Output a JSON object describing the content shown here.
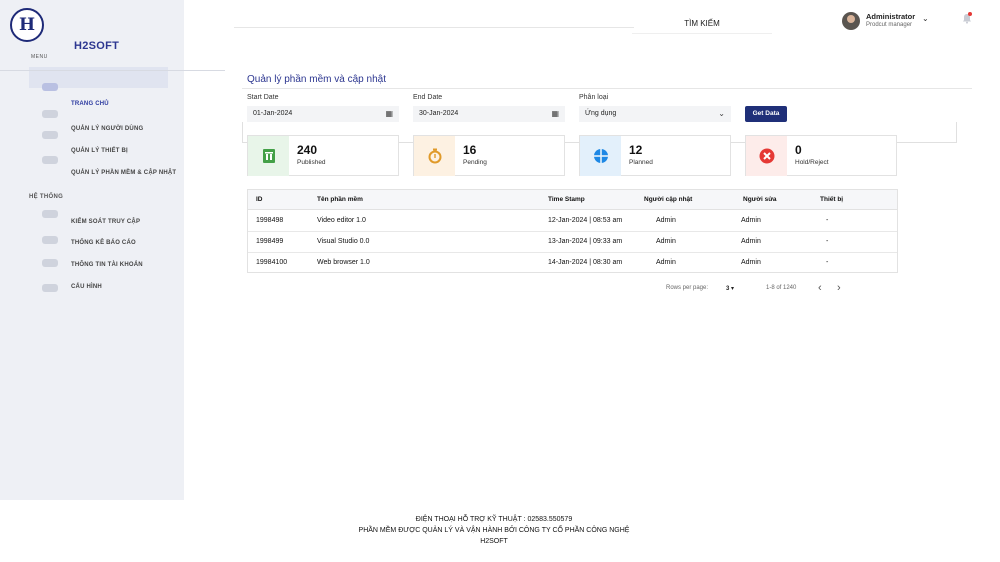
{
  "brand": {
    "logo_text": "H",
    "name": "H2SOFT"
  },
  "sidebar": {
    "menu_label": "MENU",
    "items": [
      {
        "label": "TRANG CHỦ",
        "active": true
      },
      {
        "label": "QUẢN LÝ NGƯỜI DÙNG"
      },
      {
        "label": "QUẢN LÝ THIẾT BỊ"
      },
      {
        "label": "QUẢN LÝ PHẦN MỀM & CẬP NHẬT"
      }
    ],
    "section_label": "HỆ THỐNG",
    "system_items": [
      {
        "label": "KIỂM SOÁT TRUY CẬP"
      },
      {
        "label": "THỐNG KÊ BÁO CÁO"
      },
      {
        "label": "THÔNG TIN TÀI KHOẢN"
      },
      {
        "label": "CẤU HÌNH"
      }
    ]
  },
  "header": {
    "search_label": "TÌM KIẾM",
    "user_name": "Administrator",
    "user_role": "Prodcut manager"
  },
  "page": {
    "title": "Quản lý phần mềm và cập nhật",
    "filters": {
      "start_label": "Start Date",
      "start_value": "01-Jan-2024",
      "end_label": "End Date",
      "end_value": "30-Jan-2024",
      "type_label": "Phân loại",
      "type_value": "Ứng dụng",
      "get_button": "Get Data"
    },
    "cards": [
      {
        "value": "240",
        "label": "Published",
        "color": "#43a047",
        "bg": "#e8f5e9"
      },
      {
        "value": "16",
        "label": "Pending",
        "color": "#e09a2a",
        "bg": "#fdf1e2"
      },
      {
        "value": "12",
        "label": "Planned",
        "color": "#1e88e5",
        "bg": "#e3f0fb"
      },
      {
        "value": "0",
        "label": "Hold/Reject",
        "color": "#e53935",
        "bg": "#fdecea"
      }
    ],
    "table": {
      "headers": [
        "ID",
        "Tên phần mềm",
        "Time Stamp",
        "Người cập nhật",
        "Người sửa",
        "Thiết bị"
      ],
      "rows": [
        [
          "1998498",
          "Video editor 1.0",
          "12-Jan-2024 | 08:53 am",
          "Admin",
          "Admin",
          "-"
        ],
        [
          "1998499",
          "Visual Studio 0.0",
          "13-Jan-2024 | 09:33 am",
          "Admin",
          "Admin",
          "-"
        ],
        [
          "19984100",
          "Web browser 1.0",
          "14-Jan-2024 | 08:30 am",
          "Admin",
          "Admin",
          "-"
        ]
      ]
    },
    "pagination": {
      "rows_label": "Rows per page:",
      "rows_value": "3",
      "range": "1-8 of 1240"
    }
  },
  "footer": {
    "line1": "ĐIỆN THOẠI HỖ TRỢ KỸ THUẬT : 02583.550579",
    "line2": "PHẦN MỀM ĐƯỢC QUẢN LÝ VÀ VẬN HÀNH BỞI CÔNG TY CỔ PHẦN CÔNG NGHỆ",
    "line3": "H2SOFT"
  }
}
